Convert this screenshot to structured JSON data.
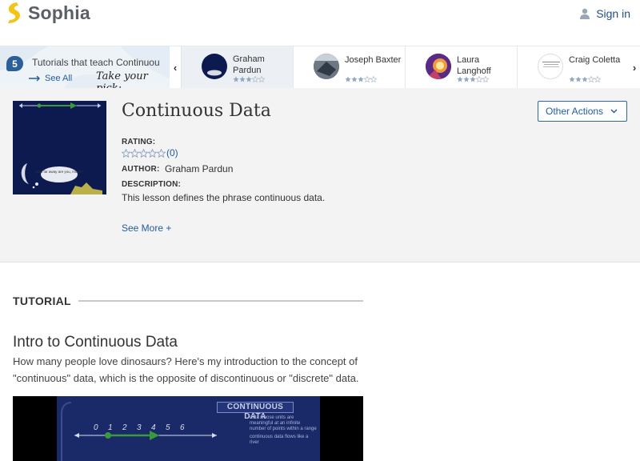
{
  "header": {
    "brand": "Sophia",
    "signin_label": "Sign in"
  },
  "carousel": {
    "count": "5",
    "intro_text": "Tutorials that teach Continuous Data",
    "see_all": "See All",
    "take_pick": "Take your pick:",
    "tutors": [
      {
        "name": "Graham Pardun",
        "stars_filled": 3,
        "active": true
      },
      {
        "name": "Joseph Baxter",
        "stars_filled": 3,
        "active": false
      },
      {
        "name": "Laura Langhoff",
        "stars_filled": 3,
        "active": false
      },
      {
        "name": "Craig Coletta",
        "stars_filled": 3,
        "active": false
      }
    ]
  },
  "lesson": {
    "title": "Continuous Data",
    "rating_label": "RATING:",
    "rating_count": "(0)",
    "author_label": "AUTHOR:",
    "author": "Graham Pardun",
    "description_label": "DESCRIPTION:",
    "description": "This lesson defines the phrase continuous data.",
    "see_more": "See More +",
    "other_actions": "Other Actions",
    "thumb_bubble": "How far away are you, moon?"
  },
  "tutorial": {
    "section_label": "TUTORIAL",
    "title": "Intro to Continuous Data",
    "description": "How many people love dinosaurs? Here's my introduction to the concept of \"continuous\" data, which is the opposite of discontinuous or \"discrete\" data.",
    "video": {
      "slide_title": "CONTINUOUS DATA",
      "slide_point_1": "data whose units are meaningful at an infinite number of points within a range",
      "slide_point_2": "continuous data flows like a river",
      "number_labels": [
        "0",
        "1",
        "2",
        "3",
        "4",
        "5",
        "6"
      ]
    }
  },
  "colors": {
    "link": "#1f5d9e",
    "brand_yellow": "#f2c418",
    "thumb_bg": "#0d1a4f"
  }
}
